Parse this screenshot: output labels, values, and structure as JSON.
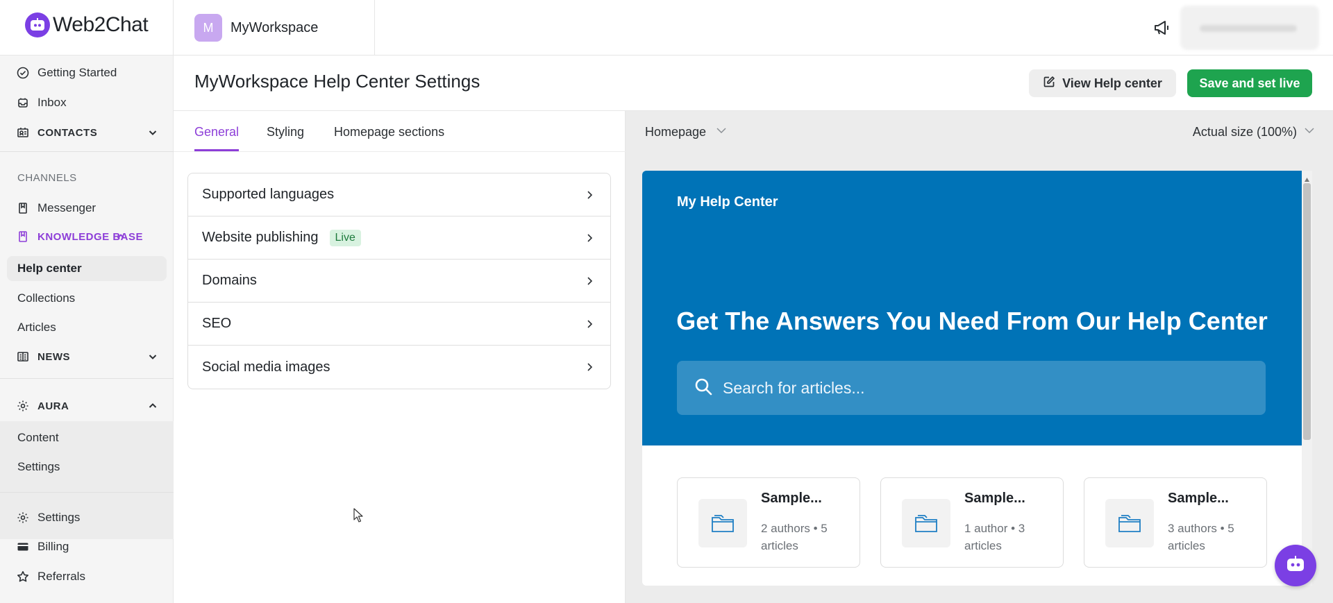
{
  "app": {
    "brand_name": "Web2Chat",
    "workspace_initial": "M",
    "workspace_name": "MyWorkspace"
  },
  "colors": {
    "accent": "#8d3ed8",
    "brand": "#7b3fe4",
    "save": "#1ea44f",
    "hero": "#0073b7"
  },
  "sidebar": {
    "getting_started": "Getting Started",
    "inbox": "Inbox",
    "contacts": "CONTACTS",
    "channels_caption": "CHANNELS",
    "messenger": "Messenger",
    "knowledge_base": "KNOWLEDGE BASE",
    "help_center": "Help center",
    "collections": "Collections",
    "articles": "Articles",
    "news": "NEWS",
    "aura": "AURA",
    "aura_content": "Content",
    "aura_settings": "Settings",
    "settings": "Settings",
    "billing": "Billing",
    "referrals": "Referrals"
  },
  "header": {
    "title": "MyWorkspace Help Center Settings",
    "view_button": "View Help center",
    "save_button": "Save and set live"
  },
  "tabs": [
    "General",
    "Styling",
    "Homepage sections"
  ],
  "settings_list": [
    {
      "label": "Supported languages"
    },
    {
      "label": "Website publishing",
      "badge": "Live"
    },
    {
      "label": "Domains"
    },
    {
      "label": "SEO"
    },
    {
      "label": "Social media images"
    }
  ],
  "preview": {
    "page_select": "Homepage",
    "size_select": "Actual size (100%)",
    "hero_brand": "My Help Center",
    "hero_title": "Get The Answers You Need From Our Help Center",
    "search_placeholder": "Search for articles...",
    "cards": [
      {
        "title": "Sample...",
        "meta": "2 authors • 5 articles"
      },
      {
        "title": "Sample...",
        "meta": "1 author • 3 articles"
      },
      {
        "title": "Sample...",
        "meta": "3 authors • 5 articles"
      }
    ]
  }
}
